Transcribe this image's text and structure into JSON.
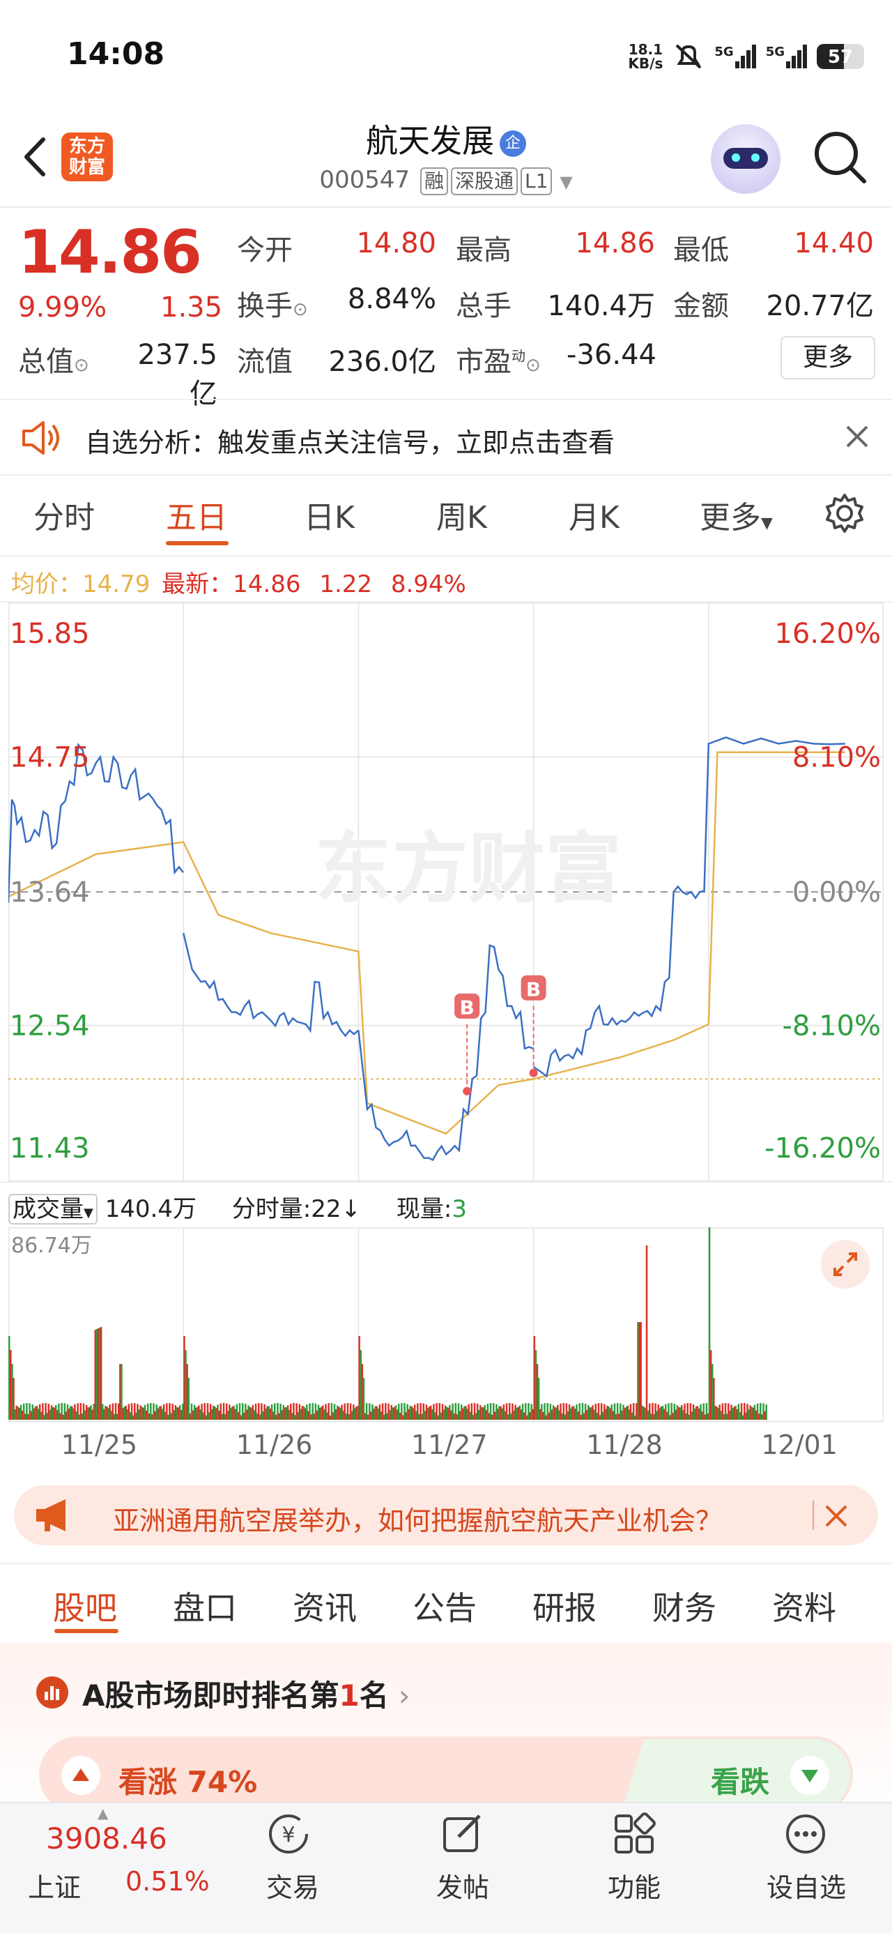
{
  "status_bar": {
    "time": "14:08",
    "net_speed_top": "18.1",
    "net_speed_unit": "KB/s",
    "sim1": "5G",
    "sim2": "5G",
    "battery": "57",
    "battery_level": 0.57
  },
  "header": {
    "logo_line1": "东方",
    "logo_line2": "财富",
    "stock_name": "航天发展",
    "name_badge": "企",
    "stock_code": "000547",
    "tags": [
      "融",
      "深股通",
      "L1"
    ]
  },
  "quote": {
    "price": "14.86",
    "change_pct": "9.99%",
    "change_amt": "1.35",
    "rows": [
      [
        {
          "label": "今开",
          "value": "14.80",
          "color": "red"
        },
        {
          "label": "最高",
          "value": "14.86",
          "color": "red"
        },
        {
          "label": "最低",
          "value": "14.40",
          "color": "red"
        }
      ],
      [
        {
          "label": "换手",
          "value": "8.84%",
          "color": "black"
        },
        {
          "label": "总手",
          "value": "140.4万",
          "color": "black"
        },
        {
          "label": "金额",
          "value": "20.77亿",
          "color": "black"
        }
      ],
      [
        {
          "label": "总值",
          "value": "237.5亿",
          "color": "black"
        },
        {
          "label": "流值",
          "value": "236.0亿",
          "color": "black"
        },
        {
          "label": "市盈",
          "value": "-36.44",
          "color": "black"
        }
      ]
    ],
    "pe_sup": "动",
    "more_label": "更多"
  },
  "notice": {
    "text": "自选分析：触发重点关注信号，立即点击查看"
  },
  "period_tabs": [
    "分时",
    "五日",
    "日K",
    "周K",
    "月K",
    "更多"
  ],
  "active_period": "五日",
  "line_legend": {
    "avg_label": "均价：",
    "avg_value": "14.79",
    "last_label": "最新：",
    "last_value": "14.86",
    "last_chg": "1.22",
    "last_pct": "8.94%"
  },
  "watermark": "东方财富",
  "chart_data": {
    "type": "line",
    "title": "",
    "days": [
      "11/25",
      "11/26",
      "11/27",
      "11/28",
      "12/01"
    ],
    "y_left_ticks": [
      "15.85",
      "14.75",
      "13.64",
      "12.54",
      "11.43"
    ],
    "y_right_ticks": [
      "16.20%",
      "8.10%",
      "0.00%",
      "-8.10%",
      "-16.20%"
    ],
    "ylim": [
      11.43,
      15.85
    ],
    "reference_price": 13.64,
    "series": [
      {
        "x_day_fraction": [
          0.0,
          0.02,
          0.05,
          0.1,
          0.15,
          0.2,
          0.25,
          0.3,
          0.35,
          0.4,
          0.45,
          0.5,
          0.55,
          0.6,
          0.65,
          0.7,
          0.75,
          0.8,
          0.85,
          0.9,
          0.95,
          1.0,
          1.05,
          1.1,
          1.15,
          1.2,
          1.25,
          1.3,
          1.35,
          1.4,
          1.45,
          1.5,
          1.55,
          1.6,
          1.65,
          1.7,
          1.75,
          1.8,
          1.85,
          1.9,
          1.95,
          2.0,
          2.05,
          2.1,
          2.15,
          2.2,
          2.25,
          2.3,
          2.35,
          2.4,
          2.45,
          2.5,
          2.55,
          2.6,
          2.65,
          2.7,
          2.75,
          2.8,
          2.85,
          2.9,
          2.95,
          3.0,
          3.05,
          3.1,
          3.15,
          3.2,
          3.25,
          3.3,
          3.35,
          3.4,
          3.45,
          3.5,
          3.55,
          3.6,
          3.65,
          3.7,
          3.75,
          3.8,
          3.85,
          3.9,
          3.95,
          4.0,
          4.2,
          4.4,
          4.6,
          4.78
        ],
        "values": [
          13.55,
          14.4,
          14.2,
          14.05,
          14.15,
          14.3,
          14.0,
          14.35,
          14.55,
          14.85,
          14.6,
          14.7,
          14.55,
          14.75,
          14.5,
          14.6,
          14.4,
          14.45,
          14.35,
          14.2,
          13.8,
          13.3,
          13.0,
          12.9,
          12.85,
          12.75,
          12.7,
          12.65,
          12.7,
          12.6,
          12.65,
          12.58,
          12.62,
          12.55,
          12.57,
          12.55,
          12.9,
          12.6,
          12.55,
          12.5,
          12.5,
          12.5,
          11.85,
          11.7,
          11.6,
          11.58,
          11.62,
          11.55,
          11.5,
          11.45,
          11.5,
          11.48,
          11.55,
          11.85,
          12.1,
          12.6,
          13.2,
          13.0,
          12.7,
          12.6,
          12.35,
          12.2,
          12.15,
          12.3,
          12.25,
          12.3,
          12.35,
          12.5,
          12.65,
          12.55,
          12.6,
          12.58,
          12.6,
          12.62,
          12.66,
          12.7,
          12.9,
          13.64,
          13.64,
          13.64,
          13.64,
          14.86,
          14.86,
          14.86,
          14.86,
          14.86
        ],
        "name": ""
      }
    ],
    "avg_series": [
      {
        "x_day_fraction": 0.0,
        "value": 13.6
      },
      {
        "x_day_fraction": 0.5,
        "value": 13.95
      },
      {
        "x_day_fraction": 1.0,
        "value": 14.05
      },
      {
        "x_day_fraction": 1.2,
        "value": 13.45
      },
      {
        "x_day_fraction": 1.5,
        "value": 13.3
      },
      {
        "x_day_fraction": 2.0,
        "value": 13.15
      },
      {
        "x_day_fraction": 2.05,
        "value": 11.9
      },
      {
        "x_day_fraction": 2.5,
        "value": 11.65
      },
      {
        "x_day_fraction": 2.8,
        "value": 12.05
      },
      {
        "x_day_fraction": 3.0,
        "value": 12.1
      },
      {
        "x_day_fraction": 3.5,
        "value": 12.28
      },
      {
        "x_day_fraction": 3.8,
        "value": 12.42
      },
      {
        "x_day_fraction": 4.0,
        "value": 12.55
      },
      {
        "x_day_fraction": 4.05,
        "value": 14.79
      },
      {
        "x_day_fraction": 4.78,
        "value": 14.79
      }
    ],
    "markers": [
      {
        "label": "B",
        "x_day_fraction": 2.62,
        "value": 12.0
      },
      {
        "label": "B",
        "x_day_fraction": 3.0,
        "value": 12.15
      }
    ]
  },
  "volume": {
    "label": "成交量",
    "total": "140.4万",
    "interval_label": "分时量:",
    "interval_value": "22",
    "now_label": "现量:",
    "now_value": "3",
    "max_label": "86.74万"
  },
  "banner": {
    "text": "亚洲通用航空展举办，如何把握航空航天产业机会？"
  },
  "bottom_tabs": [
    "股吧",
    "盘口",
    "资讯",
    "公告",
    "研报",
    "财务",
    "资料"
  ],
  "active_bottom_tab": "股吧",
  "rank": {
    "text_prefix": "A股市场即时排名第",
    "rank_num": "1",
    "text_suffix": "名"
  },
  "vote": {
    "up_label": "看涨 74%",
    "down_label": "看跌",
    "up_fraction": 0.74
  },
  "index": {
    "value": "3908.46",
    "name": "上证",
    "pct": "0.51%"
  },
  "nav": [
    {
      "label": "交易",
      "icon": "yuan-trade-icon"
    },
    {
      "label": "发帖",
      "icon": "edit-post-icon"
    },
    {
      "label": "功能",
      "icon": "grid-function-icon"
    },
    {
      "label": "设自选",
      "icon": "more-dots-icon"
    }
  ],
  "colors": {
    "up": "#d93026",
    "down": "#2e9e3e",
    "accent": "#e05a1e",
    "price_line": "#3a6fc4",
    "avg_line": "#e6b24a"
  }
}
